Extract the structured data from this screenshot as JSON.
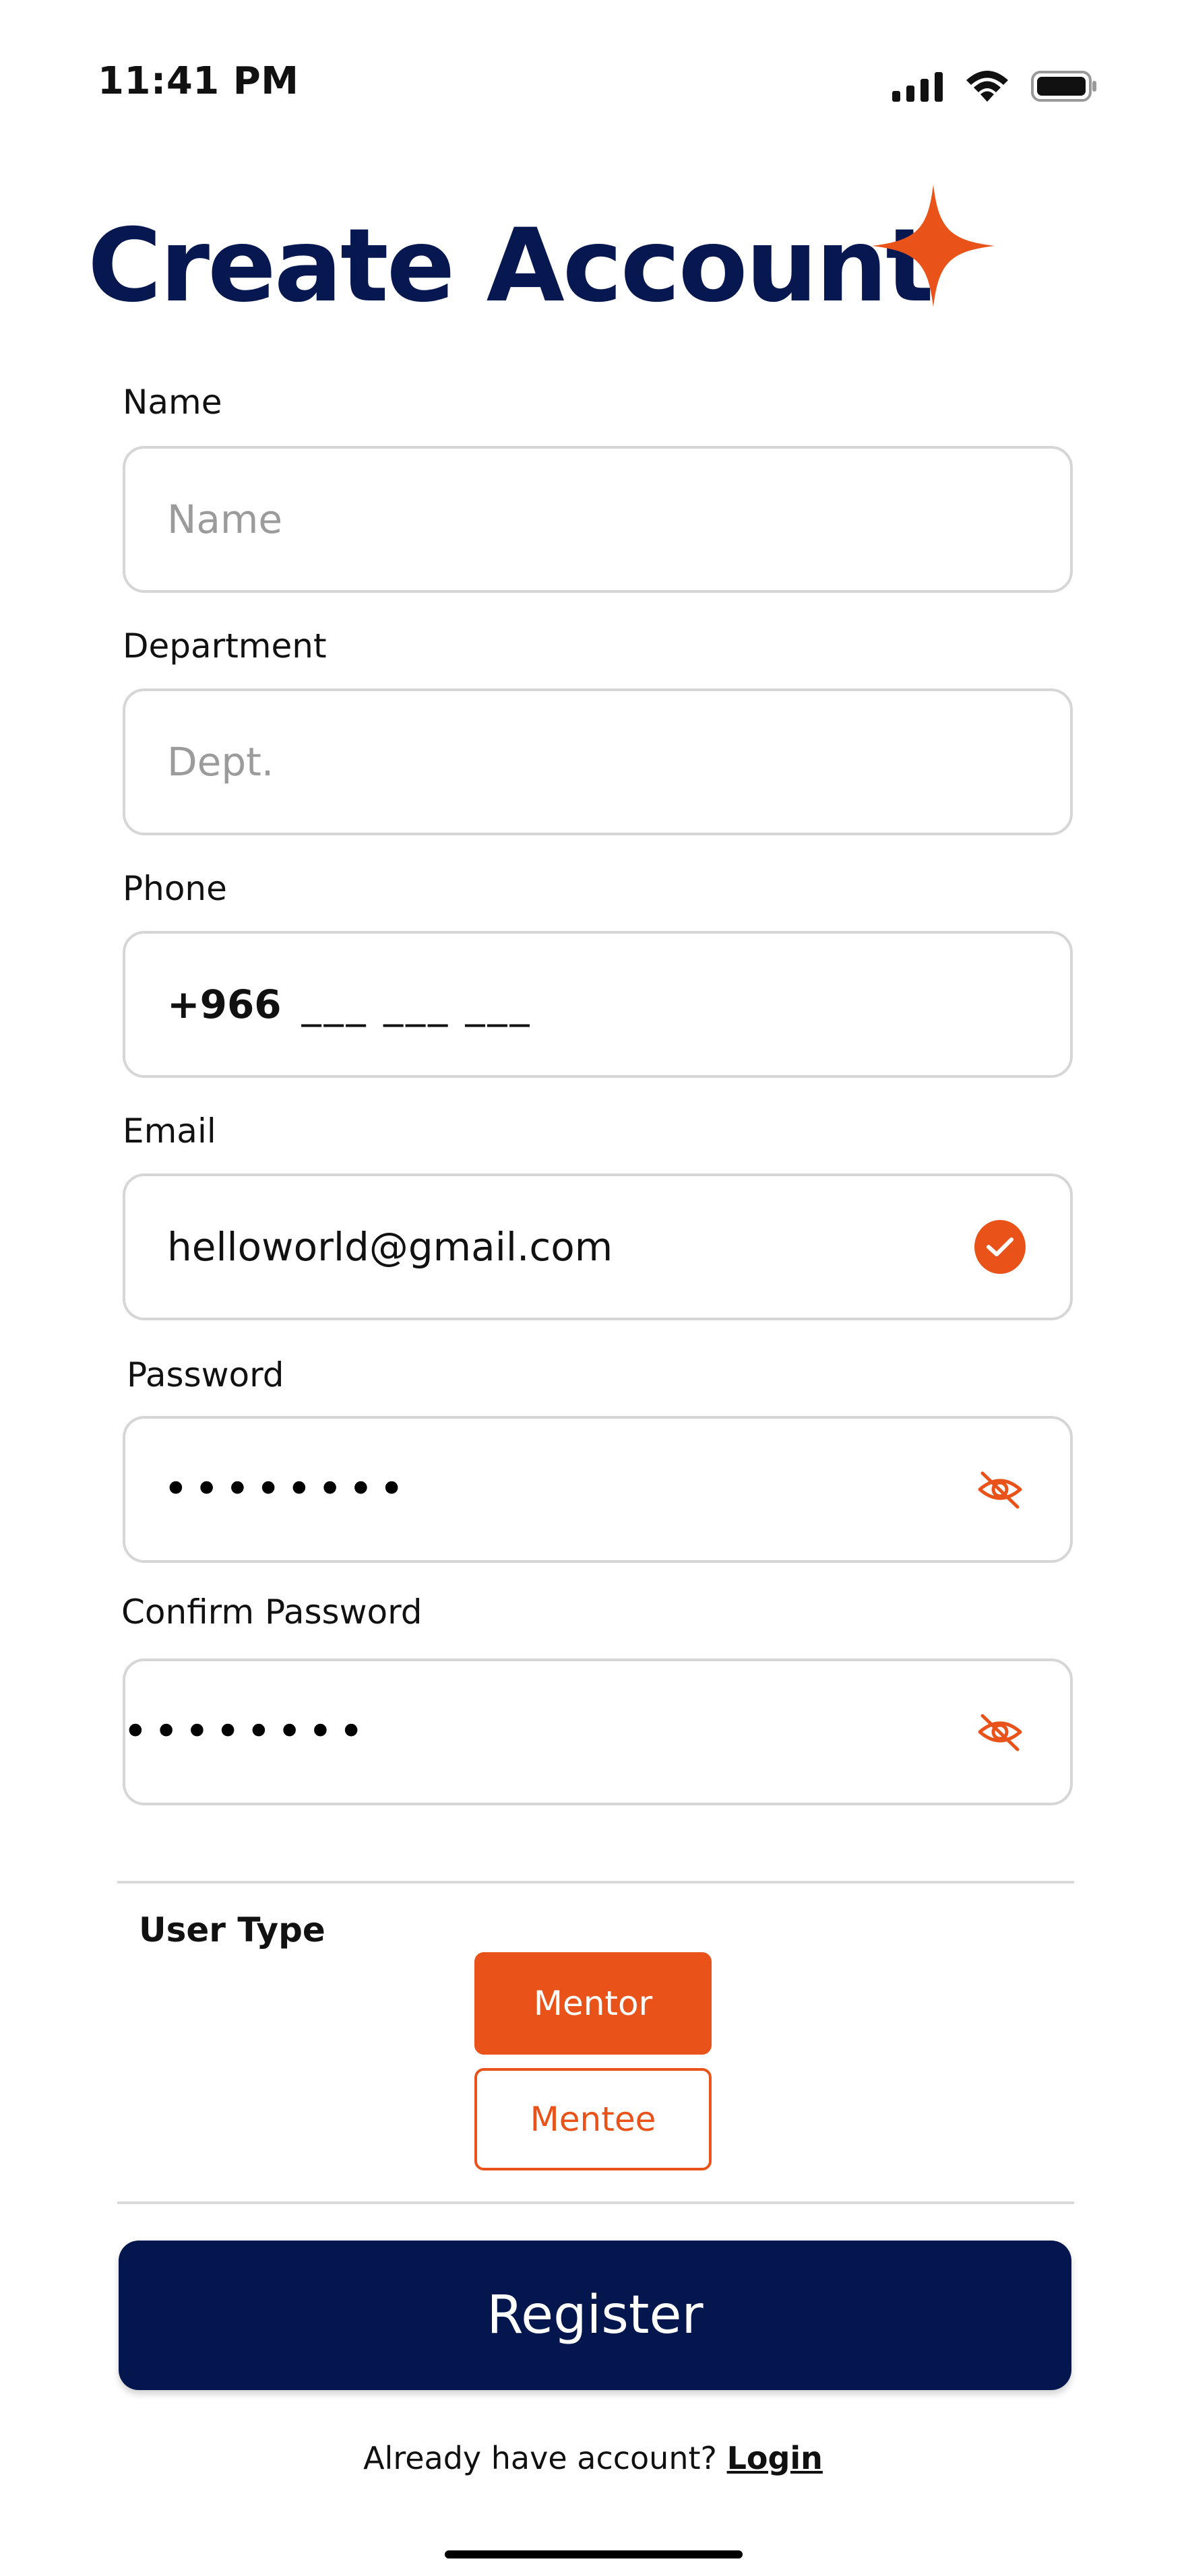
{
  "status_bar": {
    "time": "11:41 PM",
    "icons": [
      "cellular-signal-icon",
      "wifi-icon",
      "battery-icon"
    ]
  },
  "header": {
    "title": "Create Account",
    "decoration_icon": "sparkle-icon"
  },
  "form": {
    "name": {
      "label": "Name",
      "value": "",
      "placeholder": "Name"
    },
    "department": {
      "label": "Department",
      "value": "",
      "placeholder": "Dept."
    },
    "phone": {
      "label": "Phone",
      "country_code": "+966",
      "mask": "___ ___ ___"
    },
    "email": {
      "label": "Email",
      "value": "helloworld@gmail.com",
      "status_icon": "check-circle-icon"
    },
    "password": {
      "label": "Password",
      "value": "••••••••",
      "toggle_icon": "eye-off-icon"
    },
    "confirm_password": {
      "label": "Confirm Password",
      "value": "••••••••",
      "toggle_icon": "eye-off-icon"
    }
  },
  "user_type": {
    "label": "User Type",
    "options": [
      "Mentor",
      "Mentee"
    ],
    "selected": "Mentor"
  },
  "actions": {
    "register_label": "Register",
    "login_prompt": "Already have account?",
    "login_label": "Login"
  },
  "colors": {
    "primary_navy": "#04164e",
    "accent_orange": "#e9531a",
    "input_border": "#d6d6d6",
    "placeholder_gray": "#9b9b9b"
  }
}
